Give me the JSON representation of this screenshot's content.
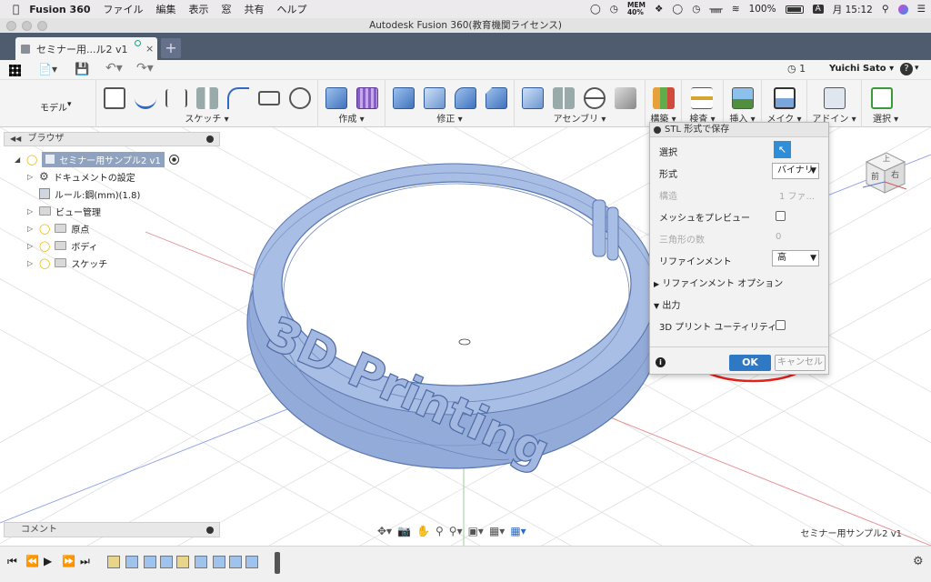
{
  "menubar": {
    "app_name": "Fusion 360",
    "items": [
      "ファイル",
      "編集",
      "表示",
      "窓",
      "共有",
      "ヘルプ"
    ],
    "mem_label": "MEM",
    "mem_value": "40%",
    "battery": "100%",
    "input_mode": "A",
    "clock": "月 15:12"
  },
  "window": {
    "title": "Autodesk Fusion 360(教育機関ライセンス)"
  },
  "tabs": {
    "active_label": "セミナー用...ル2 v1",
    "add_label": "+"
  },
  "qat": {
    "job_count": "1",
    "user_name": "Yuichi Sato",
    "help_label": "?"
  },
  "ribbon": {
    "workspace": "モデル",
    "groups": [
      "スケッチ",
      "作成",
      "修正",
      "アセンブリ",
      "構築",
      "検査",
      "挿入",
      "メイク",
      "アドイン",
      "選択"
    ]
  },
  "browser": {
    "header": "ブラウザ",
    "root": "セミナー用サンプル2 v1",
    "items": [
      "ドキュメントの設定",
      "ルール:鋼(mm)(1.8)",
      "ビュー管理",
      "原点",
      "ボディ",
      "スケッチ"
    ]
  },
  "comment": {
    "label": "コメント"
  },
  "statusbar": {
    "doc_name": "セミナー用サンプル2 v1"
  },
  "model": {
    "engraved_text": "3D Printing"
  },
  "viewcube": {
    "front": "前",
    "right": "右",
    "top": "上"
  },
  "stl_dialog": {
    "title": "STL 形式で保存",
    "rows": {
      "selection": "選択",
      "format": "形式",
      "format_value": "バイナリ",
      "structure": "構造",
      "structure_value": "1 ファ...",
      "preview_mesh": "メッシュをプレビュー",
      "triangle_count": "三角形の数",
      "triangle_value": "0",
      "refinement": "リファインメント",
      "refinement_value": "高",
      "refinement_options": "リファインメント オプション",
      "output": "出力",
      "print_utility": "3D プリント ユーティリティ..."
    },
    "ok_label": "OK",
    "cancel_label": "キャンセル"
  },
  "colors": {
    "ring_fill": "#93abd9",
    "ring_stroke": "#5a76b0",
    "ok_button": "#2f78c4",
    "highlight_circle": "#e8211c",
    "tab_bar": "#4f5b6e"
  }
}
